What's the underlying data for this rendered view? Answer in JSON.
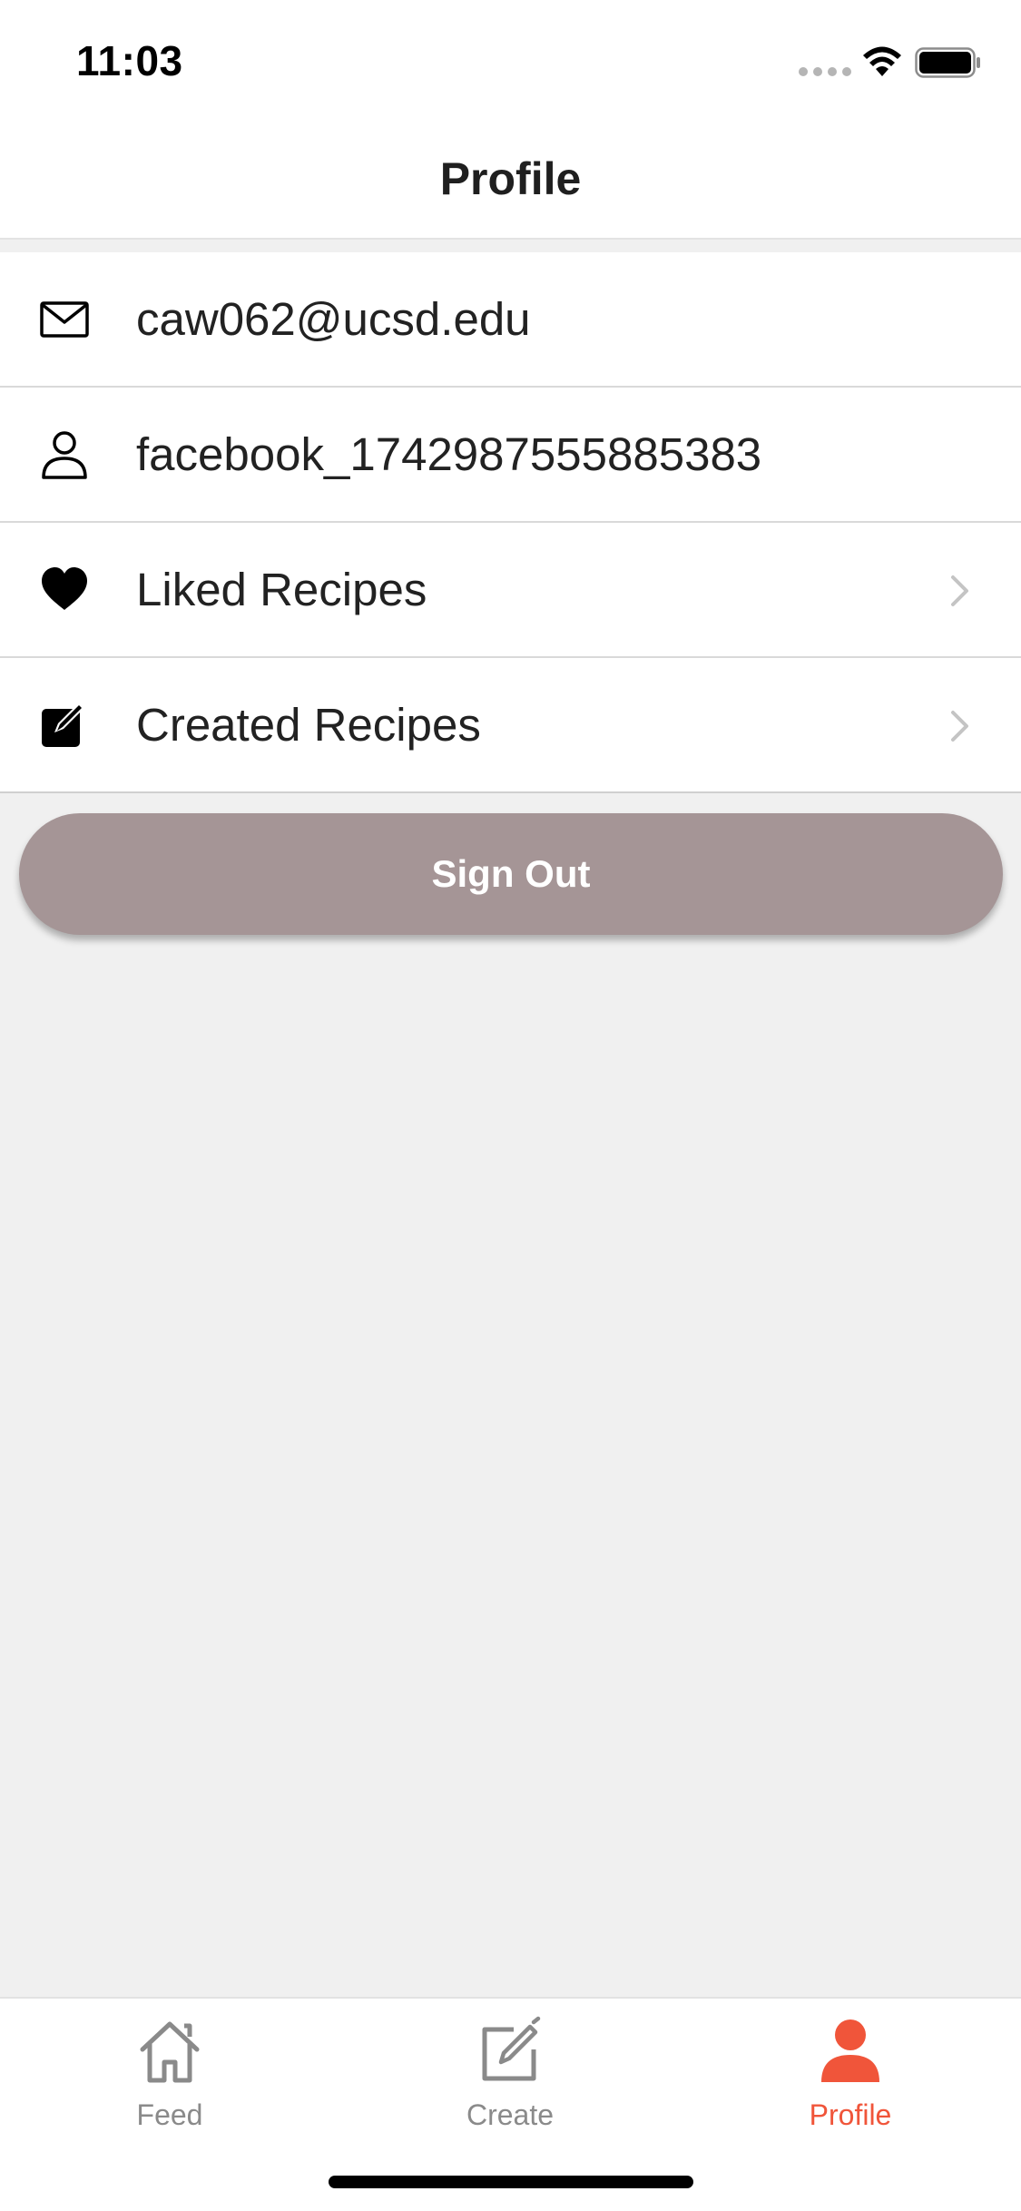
{
  "status_bar": {
    "time": "11:03",
    "icons": [
      "signal-dots-icon",
      "wifi-icon",
      "battery-icon"
    ]
  },
  "header": {
    "title": "Profile"
  },
  "profile_list": [
    {
      "icon": "envelope-icon",
      "label": "caw062@ucsd.edu",
      "has_chevron": false
    },
    {
      "icon": "person-outline-icon",
      "label": "facebook_1742987555885383",
      "has_chevron": false
    },
    {
      "icon": "heart-icon",
      "label": "Liked Recipes",
      "has_chevron": true
    },
    {
      "icon": "edit-square-icon",
      "label": "Created Recipes",
      "has_chevron": true
    }
  ],
  "sign_out_button": {
    "label": "Sign Out",
    "color": "#a59596"
  },
  "tab_bar": {
    "tabs": [
      {
        "label": "Feed",
        "icon": "home-icon",
        "active": false
      },
      {
        "label": "Create",
        "icon": "compose-icon",
        "active": false
      },
      {
        "label": "Profile",
        "icon": "person-filled-icon",
        "active": true
      }
    ],
    "active_color": "#f0553a",
    "inactive_color": "#8a8a8a"
  }
}
